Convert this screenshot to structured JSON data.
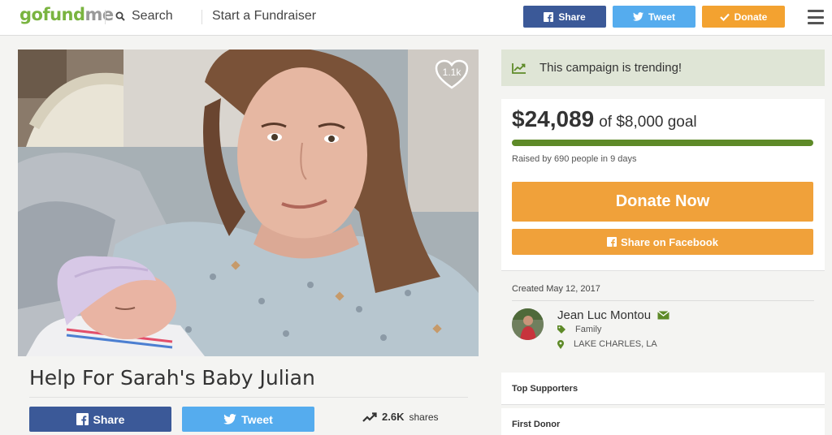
{
  "header": {
    "logo": {
      "part1": "gofund",
      "part2": "me"
    },
    "search_label": "Search",
    "start_label": "Start a Fundraiser",
    "share_label": "Share",
    "tweet_label": "Tweet",
    "donate_label": "Donate"
  },
  "campaign": {
    "title": "Help For Sarah's Baby Julian",
    "hearts": "1.1k",
    "share_label": "Share",
    "tweet_label": "Tweet",
    "shares_count": "2.6K",
    "shares_label": "shares"
  },
  "sidebar": {
    "trending": "This campaign is trending!",
    "raised_amount": "$24,089",
    "goal_text": "of $8,000 goal",
    "progress_fraction": 1.0,
    "raised_by": "Raised by 690 people in 9 days",
    "donate_now": "Donate Now",
    "share_facebook": "Share on Facebook",
    "created": "Created May 12, 2017",
    "organizer": {
      "name": "Jean Luc Montou",
      "category": "Family",
      "location": "LAKE CHARLES, LA"
    },
    "top_supporters": "Top Supporters",
    "first_donor": "First Donor"
  },
  "colors": {
    "brand_green": "#7ab440",
    "facebook": "#3b5998",
    "twitter": "#55acee",
    "donate_orange": "#f0a13a",
    "progress_green": "#5e8a28",
    "trending_bg": "#dfe5d6"
  }
}
